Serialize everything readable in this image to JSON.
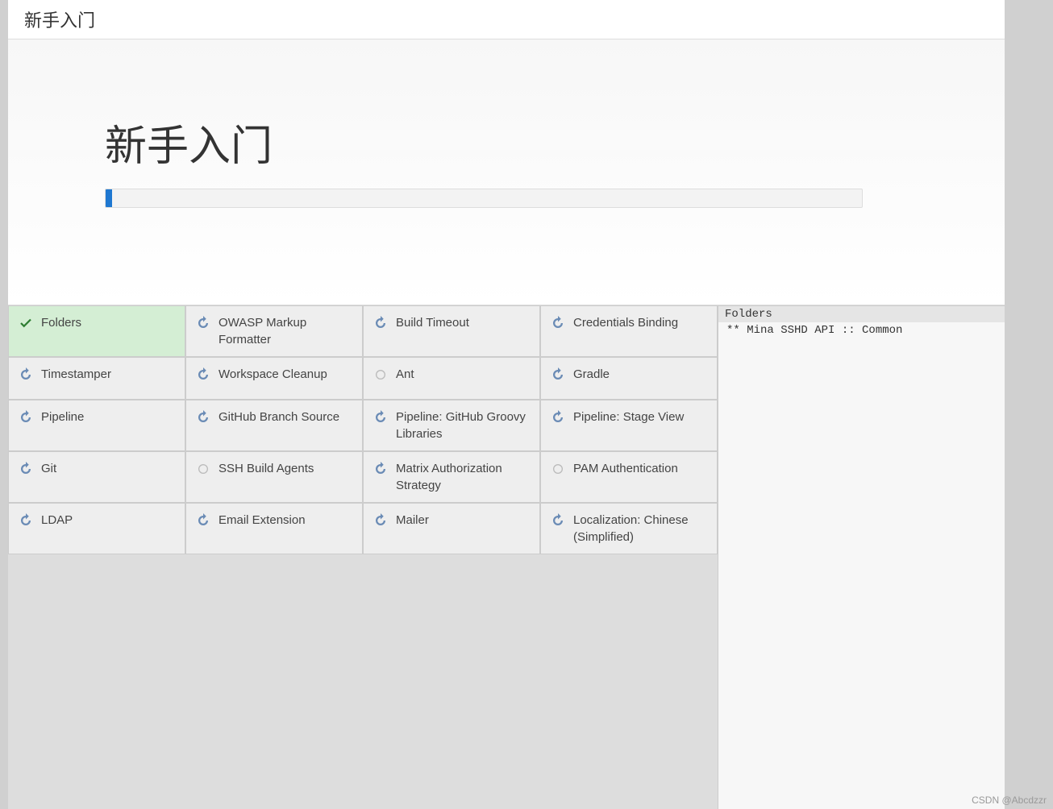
{
  "topbar": {
    "title": "新手入门"
  },
  "hero": {
    "title": "新手入门",
    "progress_percent": 1
  },
  "plugins": [
    {
      "label": "Folders",
      "status": "success"
    },
    {
      "label": "OWASP Markup Formatter",
      "status": "loading"
    },
    {
      "label": "Build Timeout",
      "status": "loading"
    },
    {
      "label": "Credentials Binding",
      "status": "loading"
    },
    {
      "label": "Timestamper",
      "status": "loading"
    },
    {
      "label": "Workspace Cleanup",
      "status": "loading"
    },
    {
      "label": "Ant",
      "status": "pending"
    },
    {
      "label": "Gradle",
      "status": "loading"
    },
    {
      "label": "Pipeline",
      "status": "loading"
    },
    {
      "label": "GitHub Branch Source",
      "status": "loading"
    },
    {
      "label": "Pipeline: GitHub Groovy Libraries",
      "status": "loading"
    },
    {
      "label": "Pipeline: Stage View",
      "status": "loading"
    },
    {
      "label": "Git",
      "status": "loading"
    },
    {
      "label": "SSH Build Agents",
      "status": "pending"
    },
    {
      "label": "Matrix Authorization Strategy",
      "status": "loading"
    },
    {
      "label": "PAM Authentication",
      "status": "pending"
    },
    {
      "label": "LDAP",
      "status": "loading"
    },
    {
      "label": "Email Extension",
      "status": "loading"
    },
    {
      "label": "Mailer",
      "status": "loading"
    },
    {
      "label": "Localization: Chinese (Simplified)",
      "status": "loading"
    }
  ],
  "sidepanel": {
    "header": "Folders",
    "line": "** Mina SSHD API :: Common"
  },
  "watermark": "CSDN @Abcdzzr"
}
